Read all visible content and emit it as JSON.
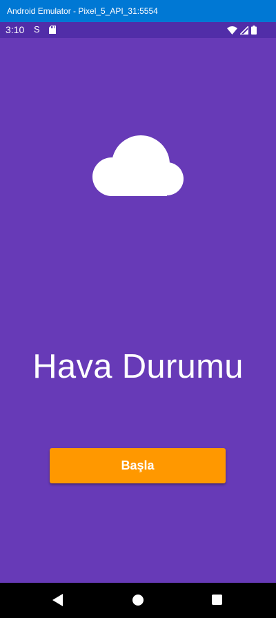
{
  "window": {
    "title": "Android Emulator - Pixel_5_API_31:5554"
  },
  "status_bar": {
    "time": "3:10",
    "app_icon_glyph": "S",
    "icons": [
      "sd-card-icon",
      "wifi-icon",
      "signal-icon",
      "battery-icon"
    ]
  },
  "main": {
    "icon": "cloud-icon",
    "title": "Hava Durumu",
    "start_button_label": "Başla"
  },
  "nav_bar": {
    "icons": [
      "back-icon",
      "home-icon",
      "recents-icon"
    ]
  },
  "colors": {
    "background": "#673ab7",
    "status_bar": "#512da8",
    "title_bar": "#0078d4",
    "button": "#ff9800",
    "nav_bar": "#000000"
  }
}
